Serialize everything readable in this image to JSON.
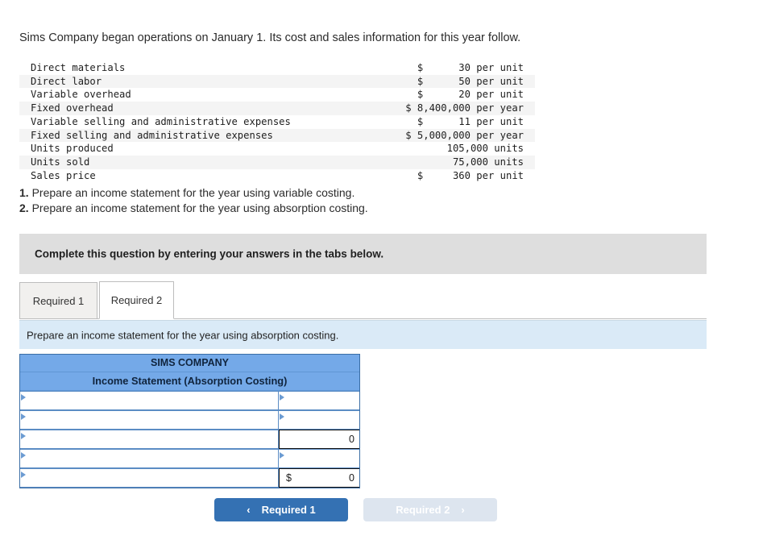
{
  "intro": "Sims Company began operations on January 1. Its cost and sales information for this year follow.",
  "facts": [
    {
      "label": "Direct materials",
      "value": "$      30 per unit"
    },
    {
      "label": "Direct labor",
      "value": "$      50 per unit"
    },
    {
      "label": "Variable overhead",
      "value": "$      20 per unit"
    },
    {
      "label": "Fixed overhead",
      "value": "$ 8,400,000 per year"
    },
    {
      "label": "Variable selling and administrative expenses",
      "value": "$      11 per unit"
    },
    {
      "label": "Fixed selling and administrative expenses",
      "value": "$ 5,000,000 per year"
    },
    {
      "label": "Units produced",
      "value": "105,000 units"
    },
    {
      "label": "Units sold",
      "value": "75,000 units"
    },
    {
      "label": "Sales price",
      "value": "$     360 per unit"
    }
  ],
  "requirements": [
    {
      "num": "1.",
      "text": "Prepare an income statement for the year using variable costing."
    },
    {
      "num": "2.",
      "text": "Prepare an income statement for the year using absorption costing."
    }
  ],
  "question_banner": {
    "text": "Complete this question by entering your answers in the tabs below."
  },
  "tabs": [
    {
      "label": "Required 1",
      "active": false
    },
    {
      "label": "Required 2",
      "active": true
    }
  ],
  "prompt_bar": {
    "text": "Prepare an income statement for the year using absorption costing."
  },
  "answer_grid": {
    "header_line1": "SIMS COMPANY",
    "header_line2": "Income Statement (Absorption Costing)",
    "rows": [
      {
        "label": "",
        "amount": "",
        "currency": "",
        "left_dropdown": true,
        "right_dropdown": true,
        "calculated": false
      },
      {
        "label": "",
        "amount": "",
        "currency": "",
        "left_dropdown": true,
        "right_dropdown": true,
        "calculated": false
      },
      {
        "label": "",
        "amount": "0",
        "currency": "",
        "left_dropdown": true,
        "right_dropdown": false,
        "calculated": true
      },
      {
        "label": "",
        "amount": "",
        "currency": "",
        "left_dropdown": true,
        "right_dropdown": true,
        "calculated": false
      },
      {
        "label": "",
        "amount": "0",
        "currency": "$",
        "left_dropdown": true,
        "right_dropdown": false,
        "calculated": true
      }
    ]
  },
  "nav": {
    "prev_label": "Required 1",
    "prev_chevron": "‹",
    "next_label": "Required 2",
    "next_chevron": "›"
  },
  "colors": {
    "header_blue": "#74a9e8",
    "grid_border_blue": "#3b6ea5",
    "prompt_bar_blue": "#daeaf7",
    "banner_grey": "#dedede",
    "primary_button": "#3471b3",
    "disabled_button": "#dde5ef"
  }
}
